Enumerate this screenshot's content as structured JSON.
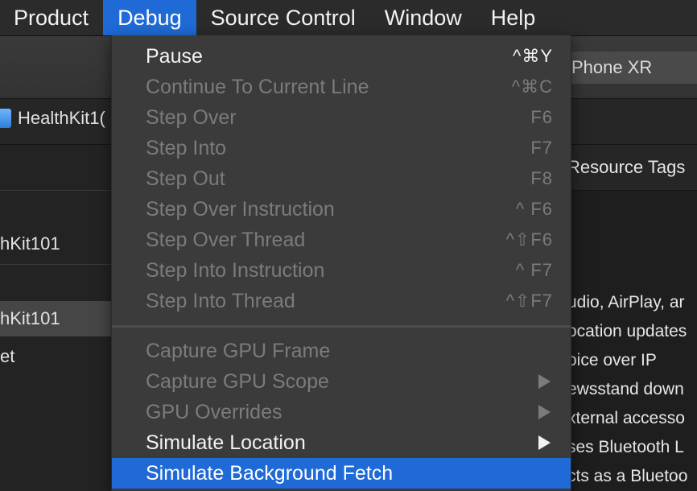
{
  "menubar": {
    "items": [
      {
        "label": "Product"
      },
      {
        "label": "Debug"
      },
      {
        "label": "Source Control"
      },
      {
        "label": "Window"
      },
      {
        "label": "Help"
      }
    ]
  },
  "background": {
    "device_selector": "Phone XR",
    "project_tab": "HealthKit1(",
    "sidebar_rows": [
      "hKit101",
      "hKit101",
      "et"
    ],
    "main_topbar": "Resource Tags",
    "capability_lines": [
      "udio, AirPlay, ar",
      "ocation updates",
      "oice over IP",
      "ewsstand down",
      "xternal accesso",
      "ses Bluetooth L",
      "cts as a Bluetoo"
    ]
  },
  "debug_menu": {
    "items": [
      {
        "label": "Pause",
        "shortcut": "^⌘Y"
      },
      {
        "label": "Continue To Current Line",
        "shortcut": "^⌘C"
      },
      {
        "label": "Step Over",
        "shortcut": "F6"
      },
      {
        "label": "Step Into",
        "shortcut": "F7"
      },
      {
        "label": "Step Out",
        "shortcut": "F8"
      },
      {
        "label": "Step Over Instruction",
        "shortcut": "^ F6"
      },
      {
        "label": "Step Over Thread",
        "shortcut": "^⇧F6"
      },
      {
        "label": "Step Into Instruction",
        "shortcut": "^ F7"
      },
      {
        "label": "Step Into Thread",
        "shortcut": "^⇧F7"
      },
      {
        "label": "Capture GPU Frame"
      },
      {
        "label": "Capture GPU Scope"
      },
      {
        "label": "GPU Overrides"
      },
      {
        "label": "Simulate Location"
      },
      {
        "label": "Simulate Background Fetch"
      }
    ]
  }
}
